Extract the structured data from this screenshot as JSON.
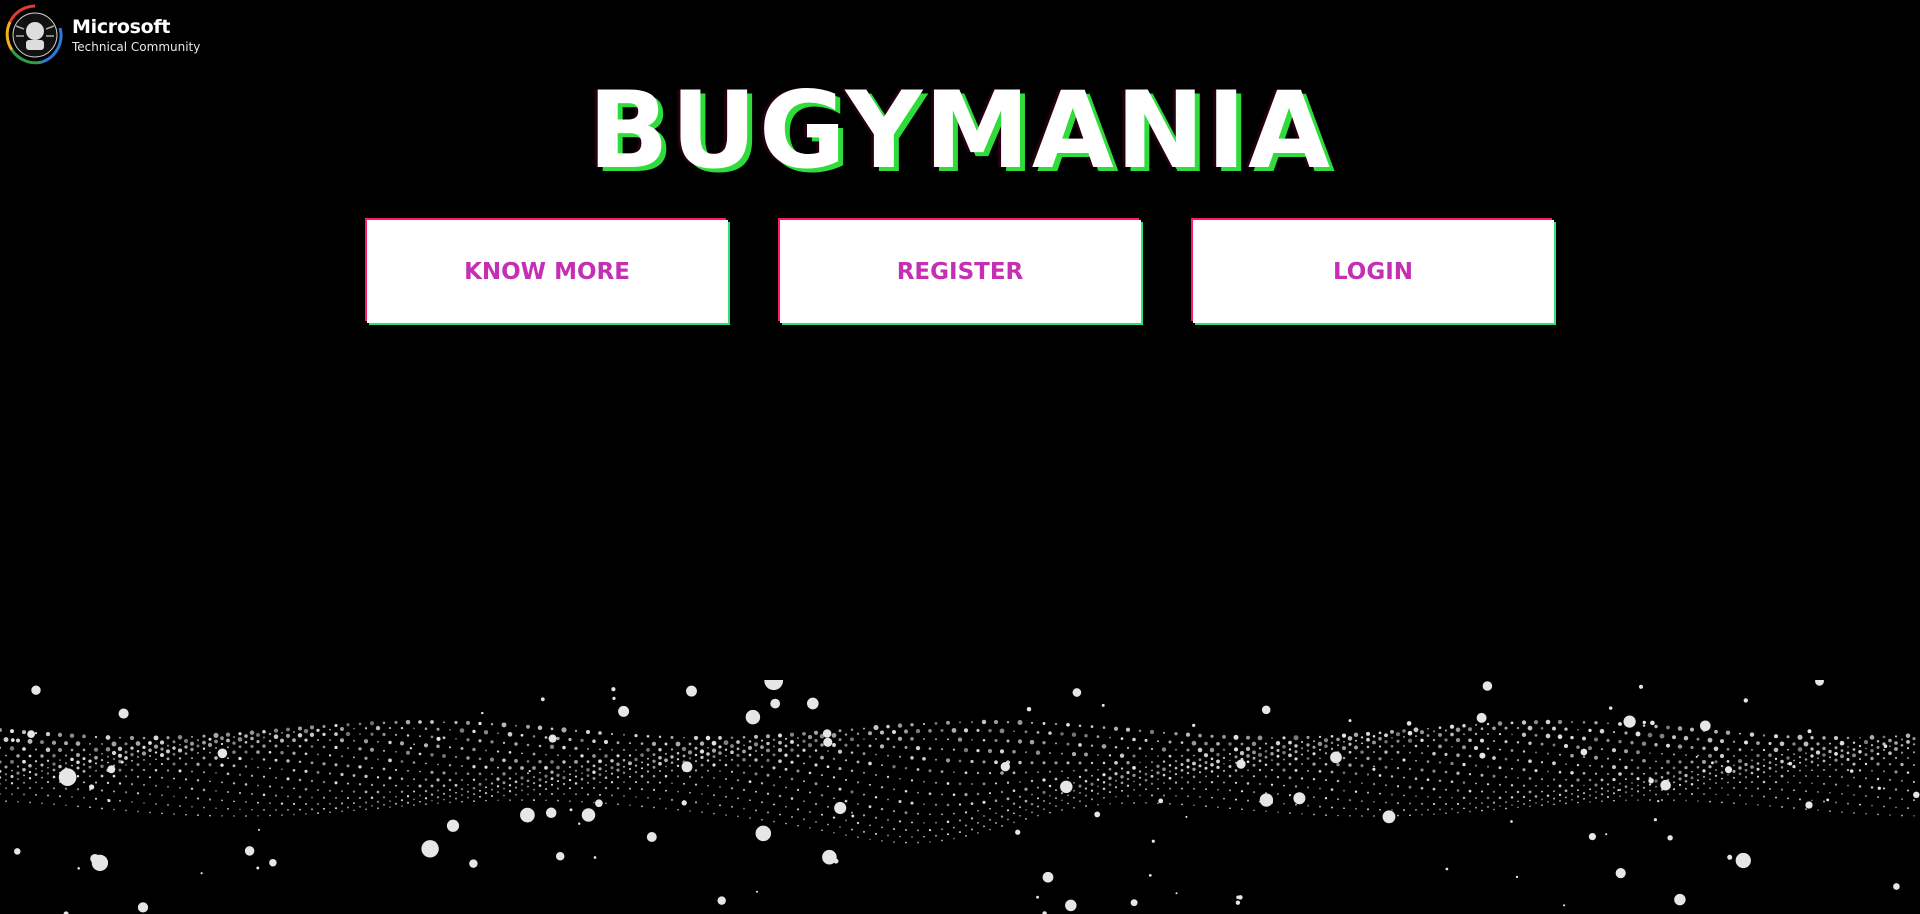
{
  "logo": {
    "brand": "Microsoft",
    "subtitle": "Technical Community",
    "icon": "mtc-emblem-icon"
  },
  "hero": {
    "title": "BUGYMANIA"
  },
  "buttons": [
    {
      "label": "KNOW MORE"
    },
    {
      "label": "REGISTER"
    },
    {
      "label": "LOGIN"
    }
  ],
  "colors": {
    "background": "#000000",
    "button_text": "#c42fb3",
    "glitch_green": "#2fdc3c",
    "glitch_pink": "#ff1a6e",
    "particles": "#e6e6e6"
  }
}
